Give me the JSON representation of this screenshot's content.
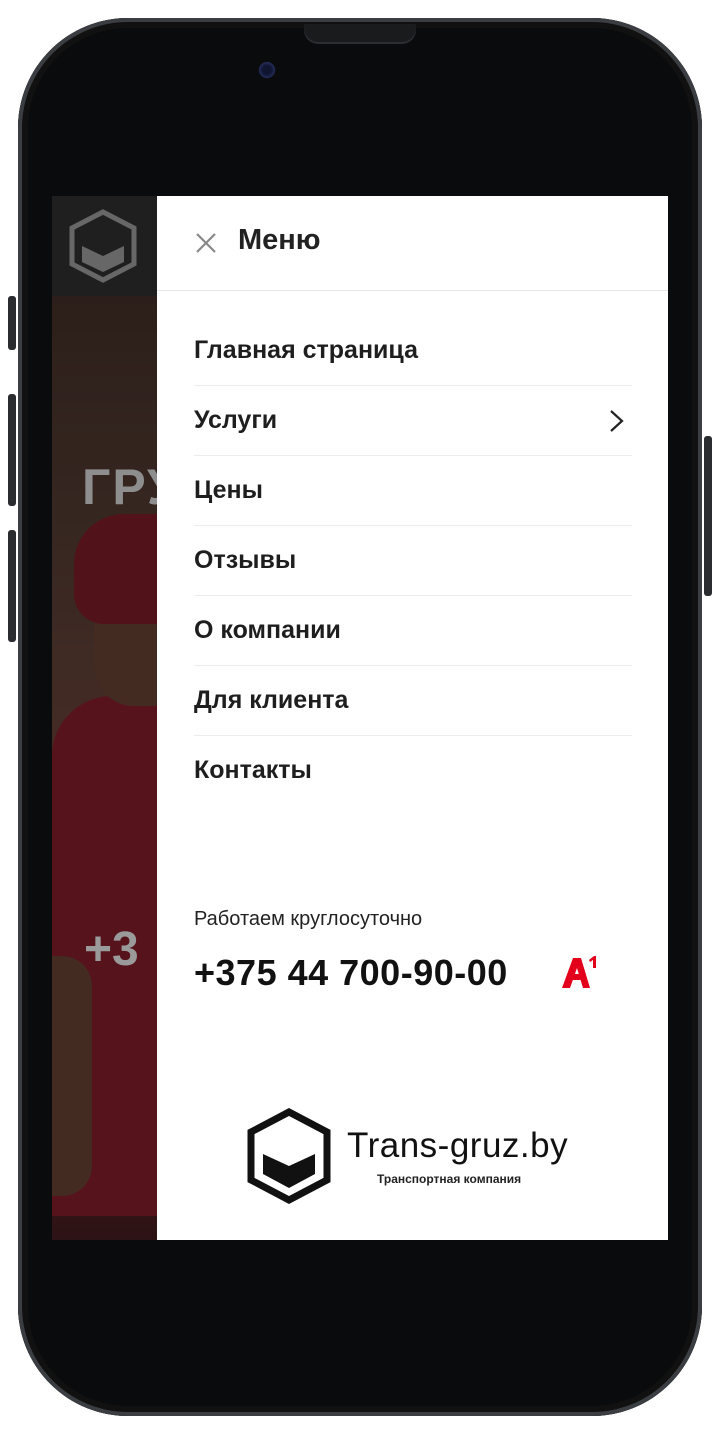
{
  "background": {
    "hero_line1": "ГРУ",
    "hero_phone": "+3"
  },
  "menu": {
    "title": "Меню",
    "items": [
      {
        "label": "Главная страница",
        "has_submenu": false
      },
      {
        "label": "Услуги",
        "has_submenu": true
      },
      {
        "label": "Цены",
        "has_submenu": false
      },
      {
        "label": "Отзывы",
        "has_submenu": false
      },
      {
        "label": "О компании",
        "has_submenu": false
      },
      {
        "label": "Для клиента",
        "has_submenu": false
      },
      {
        "label": "Контакты",
        "has_submenu": false
      }
    ]
  },
  "contact": {
    "hours": "Работаем круглосуточно",
    "phone": "+375 44 700-90-00",
    "operator_logo_text": "A1"
  },
  "brand": {
    "name": "Trans-gruz.by",
    "tagline": "Транспортная компания"
  },
  "colors": {
    "accent": "#e3001b",
    "text": "#1e1e1e",
    "divider": "#ececec"
  },
  "icons": {
    "close": "close-icon",
    "chevron": "chevron-right-icon",
    "logo": "box-logo-icon"
  }
}
